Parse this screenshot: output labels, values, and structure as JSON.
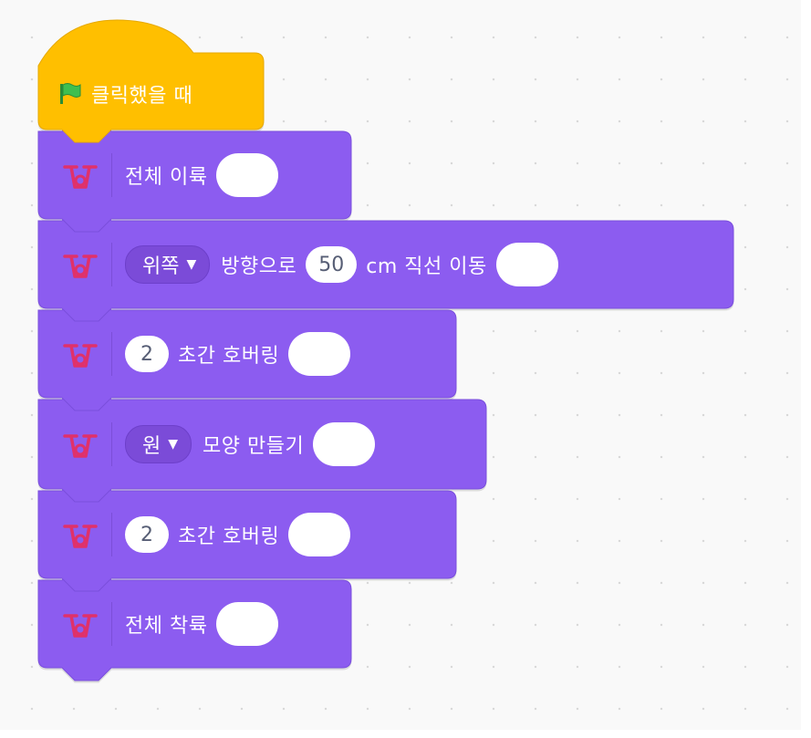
{
  "colors": {
    "event_block": "#ffbf00",
    "drone_block": "#8c5cf0",
    "drone_icon": "#e0316a",
    "flag": "#3fbf4f"
  },
  "event": {
    "label": "클릭했을 때",
    "icon": "green-flag-icon"
  },
  "blocks": [
    {
      "icon": "drone-icon",
      "label": "전체 이륙"
    },
    {
      "icon": "drone-icon",
      "direction": "위쪽",
      "text1": "방향으로",
      "distance": "50",
      "text2": "cm 직선 이동"
    },
    {
      "icon": "drone-icon",
      "seconds": "2",
      "label": "초간 호버링"
    },
    {
      "icon": "drone-icon",
      "shape": "원",
      "label": "모양 만들기"
    },
    {
      "icon": "drone-icon",
      "seconds": "2",
      "label": "초간 호버링"
    },
    {
      "icon": "drone-icon",
      "label": "전체 착륙"
    }
  ]
}
